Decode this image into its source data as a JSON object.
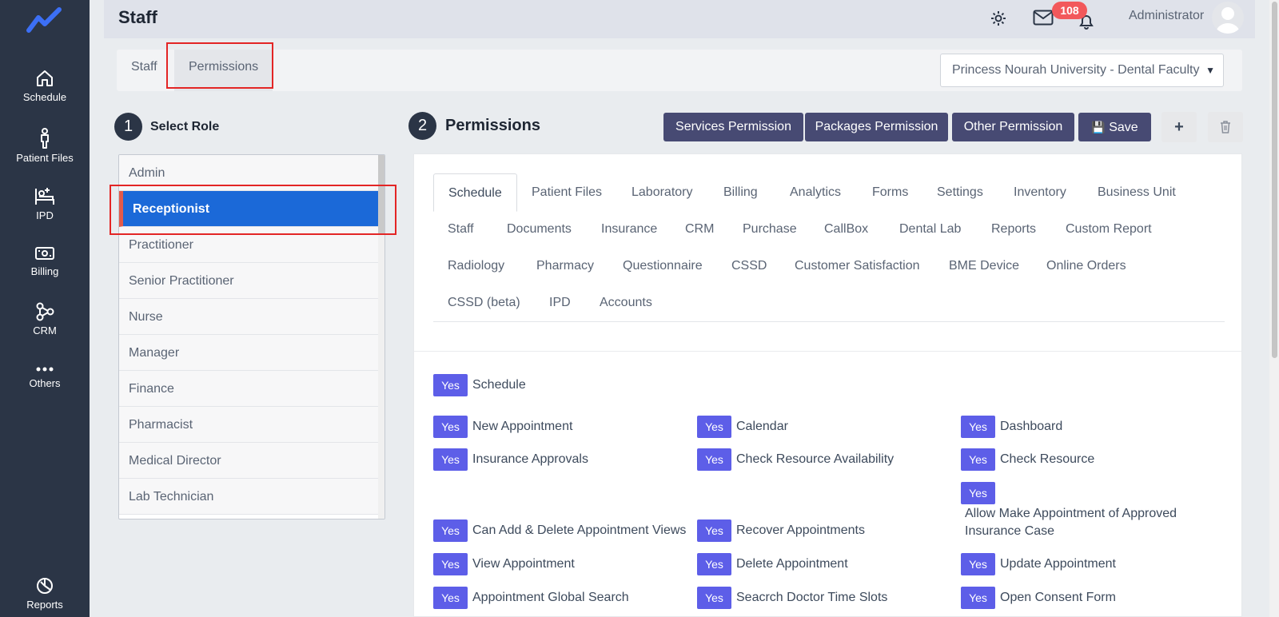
{
  "sidebar": {
    "items": [
      {
        "label": "Schedule",
        "icon": "home-icon"
      },
      {
        "label": "Patient Files",
        "icon": "person-icon"
      },
      {
        "label": "IPD",
        "icon": "bed-icon"
      },
      {
        "label": "Billing",
        "icon": "money-icon"
      },
      {
        "label": "CRM",
        "icon": "network-icon"
      },
      {
        "label": "Others",
        "icon": "dots-icon"
      }
    ],
    "bottom": {
      "label": "Reports",
      "icon": "chart-icon"
    }
  },
  "header": {
    "title": "Staff",
    "notification_count": "108",
    "user_name": "Administrator"
  },
  "top_tabs": [
    {
      "label": "Staff"
    },
    {
      "label": "Permissions"
    }
  ],
  "facility": {
    "selected": "Princess Nourah University - Dental Faculty"
  },
  "roles_section": {
    "step": "1",
    "title": "Select Role",
    "roles": [
      "Admin",
      "Receptionist",
      "Practitioner",
      "Senior Practitioner",
      "Nurse",
      "Manager",
      "Finance",
      "Pharmacist",
      "Medical Director",
      "Lab Technician"
    ],
    "selected": "Receptionist"
  },
  "permissions_section": {
    "step": "2",
    "title": "Permissions",
    "buttons": {
      "services": "Services Permission",
      "packages": "Packages Permission",
      "other": "Other Permission",
      "save": "Save"
    },
    "module_tabs": [
      [
        "Schedule",
        "Patient Files",
        "Laboratory",
        "Billing",
        "Analytics",
        "Forms",
        "Settings",
        "Inventory",
        "Business Unit"
      ],
      [
        "Staff",
        "Documents",
        "Insurance",
        "CRM",
        "Purchase",
        "CallBox",
        "Dental Lab",
        "Reports",
        "Custom Report"
      ],
      [
        "Radiology",
        "Pharmacy",
        "Questionnaire",
        "CSSD",
        "Customer Satisfaction",
        "BME Device",
        "Online Orders"
      ],
      [
        "CSSD (beta)",
        "IPD",
        "Accounts"
      ]
    ],
    "active_tab": "Schedule",
    "yes_label": "Yes",
    "master": "Schedule",
    "items": [
      "New Appointment",
      "Calendar",
      "Dashboard",
      "Insurance Approvals",
      "Check Resource Availability",
      "Check Resource",
      "Allow Make Appointment of Approved Insurance Case",
      "Can Add & Delete Appointment Views",
      "Recover Appointments",
      "View Appointment",
      "Delete Appointment",
      "Update Appointment",
      "Appointment Global Search",
      "Seacrch Doctor Time Slots",
      "Open Consent Form"
    ]
  }
}
